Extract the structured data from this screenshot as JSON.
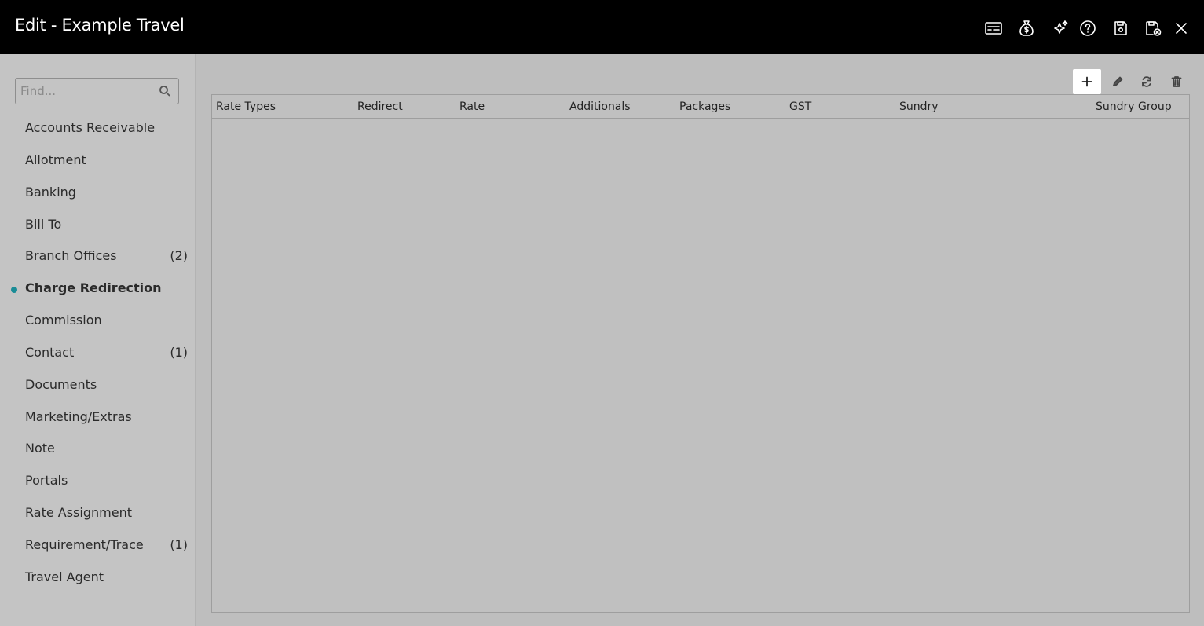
{
  "window": {
    "title": "Edit - Example Travel",
    "icons": [
      "id-card-icon",
      "money-bag-icon",
      "sparkle-icon",
      "help-icon",
      "save-icon",
      "save-close-icon",
      "close-icon"
    ]
  },
  "sidebar": {
    "search_placeholder": "Find...",
    "items": [
      {
        "label": "Accounts Receivable",
        "count": ""
      },
      {
        "label": "Allotment",
        "count": ""
      },
      {
        "label": "Banking",
        "count": ""
      },
      {
        "label": "Bill To",
        "count": ""
      },
      {
        "label": "Branch Offices",
        "count": "(2)"
      },
      {
        "label": "Charge Redirection",
        "count": "",
        "active": true
      },
      {
        "label": "Commission",
        "count": ""
      },
      {
        "label": "Contact",
        "count": "(1)"
      },
      {
        "label": "Documents",
        "count": ""
      },
      {
        "label": "Marketing/Extras",
        "count": ""
      },
      {
        "label": "Note",
        "count": ""
      },
      {
        "label": "Portals",
        "count": ""
      },
      {
        "label": "Rate Assignment",
        "count": ""
      },
      {
        "label": "Requirement/Trace",
        "count": "(1)"
      },
      {
        "label": "Travel Agent",
        "count": ""
      }
    ],
    "active_color": "#1a8c96"
  },
  "toolbar": {
    "buttons": [
      "add-icon",
      "edit-icon",
      "refresh-icon",
      "delete-icon"
    ]
  },
  "table": {
    "columns": [
      "Rate Types",
      "Redirect",
      "Rate",
      "Additionals",
      "Packages",
      "GST",
      "Sundry",
      "Sundry Group"
    ],
    "rows": []
  }
}
